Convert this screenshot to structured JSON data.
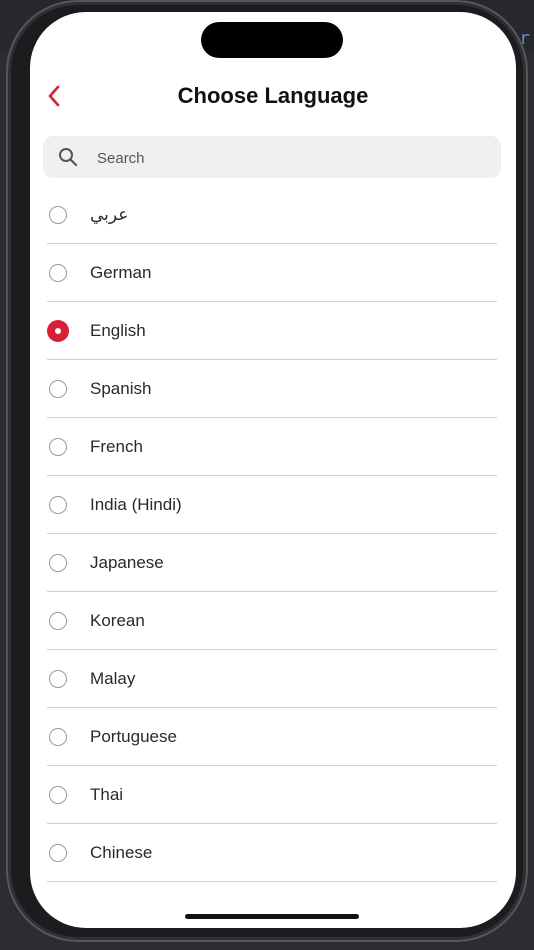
{
  "header": {
    "title": "Choose Language",
    "back_icon": "chevron-left-icon"
  },
  "search": {
    "placeholder": "Search",
    "value": ""
  },
  "languages": [
    {
      "label": "عربي",
      "selected": false
    },
    {
      "label": "German",
      "selected": false
    },
    {
      "label": "English",
      "selected": true
    },
    {
      "label": "Spanish",
      "selected": false
    },
    {
      "label": "French",
      "selected": false
    },
    {
      "label": "India (Hindi)",
      "selected": false
    },
    {
      "label": "Japanese",
      "selected": false
    },
    {
      "label": "Korean",
      "selected": false
    },
    {
      "label": "Malay",
      "selected": false
    },
    {
      "label": "Portuguese",
      "selected": false
    },
    {
      "label": "Thai",
      "selected": false
    },
    {
      "label": "Chinese",
      "selected": false
    }
  ],
  "colors": {
    "accent": "#d71f35",
    "background": "#ffffff",
    "search_bg": "#f0f0f2",
    "divider": "#cfcfd4"
  }
}
